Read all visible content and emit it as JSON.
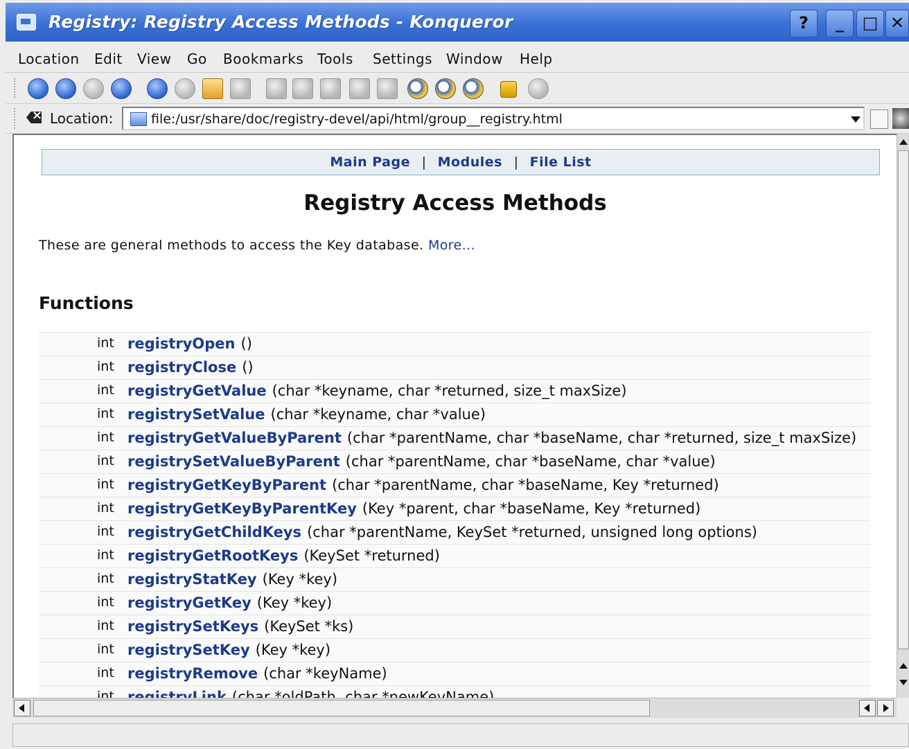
{
  "window": {
    "title": "Registry: Registry Access Methods - Konqueror",
    "buttons": {
      "help": "?",
      "minimize": "_",
      "maximize": "□",
      "close": "✕"
    }
  },
  "menubar": {
    "items": [
      {
        "label": "Location"
      },
      {
        "label": "Edit"
      },
      {
        "label": "View"
      },
      {
        "label": "Go"
      },
      {
        "label": "Bookmarks"
      },
      {
        "label": "Tools"
      },
      {
        "label": "Settings"
      },
      {
        "label": "Window"
      },
      {
        "label": "Help"
      }
    ]
  },
  "toolbar": {
    "icons": [
      "back-icon",
      "forward-icon",
      "up-icon",
      "home-icon",
      "reload-icon",
      "stop-icon",
      "edit-icon",
      "spellcheck-icon",
      "cut-icon",
      "copy-icon",
      "paste-icon",
      "print-icon",
      "print-preview-icon",
      "find-icon",
      "zoom-in-icon",
      "zoom-out-icon",
      "lock-icon",
      "security-icon"
    ]
  },
  "location": {
    "label": "Location:",
    "url": "file:/usr/share/doc/registry-devel/api/html/group__registry.html"
  },
  "page": {
    "nav": {
      "main_page": "Main Page",
      "modules": "Modules",
      "file_list": "File List",
      "separator": "|"
    },
    "title": "Registry Access Methods",
    "intro": "These are general methods to access the Key database.",
    "more_link": "More...",
    "section_title": "Functions",
    "functions": [
      {
        "type": "int",
        "name": "registryOpen",
        "args": "()"
      },
      {
        "type": "int",
        "name": "registryClose",
        "args": "()"
      },
      {
        "type": "int",
        "name": "registryGetValue",
        "args": "(char *keyname, char *returned, size_t maxSize)"
      },
      {
        "type": "int",
        "name": "registrySetValue",
        "args": "(char *keyname, char *value)"
      },
      {
        "type": "int",
        "name": "registryGetValueByParent",
        "args": "(char *parentName, char *baseName, char *returned, size_t maxSize)"
      },
      {
        "type": "int",
        "name": "registrySetValueByParent",
        "args": "(char *parentName, char *baseName, char *value)"
      },
      {
        "type": "int",
        "name": "registryGetKeyByParent",
        "args": "(char *parentName, char *baseName, Key *returned)"
      },
      {
        "type": "int",
        "name": "registryGetKeyByParentKey",
        "args": "(Key *parent, char *baseName, Key *returned)"
      },
      {
        "type": "int",
        "name": "registryGetChildKeys",
        "args": "(char *parentName, KeySet *returned, unsigned long options)"
      },
      {
        "type": "int",
        "name": "registryGetRootKeys",
        "args": "(KeySet *returned)"
      },
      {
        "type": "int",
        "name": "registryStatKey",
        "args": "(Key *key)"
      },
      {
        "type": "int",
        "name": "registryGetKey",
        "args": "(Key *key)"
      },
      {
        "type": "int",
        "name": "registrySetKeys",
        "args": "(KeySet *ks)"
      },
      {
        "type": "int",
        "name": "registrySetKey",
        "args": "(Key *key)"
      },
      {
        "type": "int",
        "name": "registryRemove",
        "args": "(char *keyName)"
      },
      {
        "type": "int",
        "name": "registryLink",
        "args": "(char *oldPath, char *newKeyName)"
      }
    ]
  },
  "colors": {
    "titlebar": "#3a70d6",
    "link": "#1d3a8a",
    "navbar_bg": "#e8eef2",
    "navbar_border": "#84b0c7"
  },
  "statusbar": {
    "text": ""
  }
}
